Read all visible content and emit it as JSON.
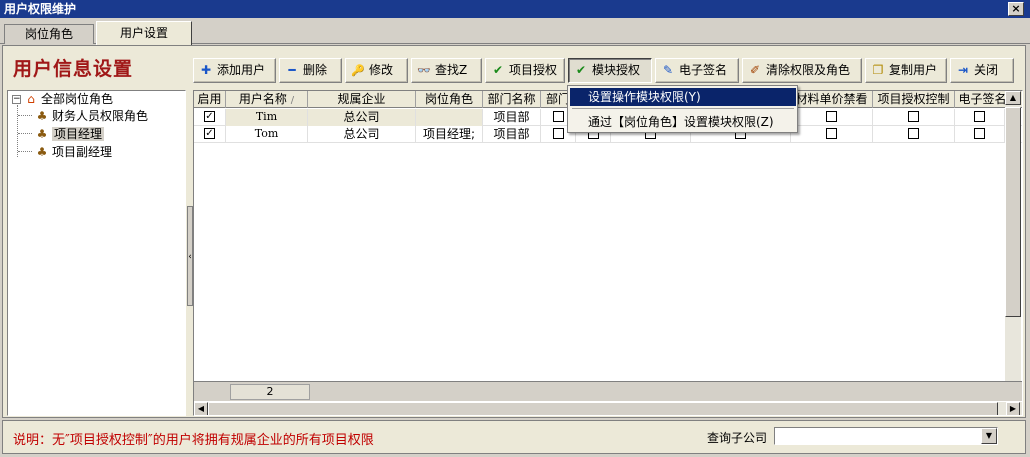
{
  "window": {
    "title": "用户权限维护",
    "close_glyph": "×"
  },
  "tabs": [
    {
      "label": "岗位角色"
    },
    {
      "label": "用户设置"
    }
  ],
  "header": {
    "title": "用户信息设置"
  },
  "toolbar": {
    "buttons": [
      {
        "label": "添加用户",
        "icon": "plus-icon",
        "glyph": "✚",
        "color": "#1a56c8"
      },
      {
        "label": "删除",
        "icon": "minus-icon",
        "glyph": "━",
        "color": "#1a56c8"
      },
      {
        "label": "修改",
        "icon": "key-icon",
        "glyph": "🔑",
        "color": "#b08800"
      },
      {
        "label": "查找Z",
        "icon": "binoculars-icon",
        "glyph": "👓",
        "color": "#000000"
      },
      {
        "label": "项目授权",
        "icon": "check-icon",
        "glyph": "✔",
        "color": "#1a8a1a"
      },
      {
        "label": "模块授权",
        "icon": "check-icon",
        "glyph": "✔",
        "color": "#1a8a1a"
      },
      {
        "label": "电子签名",
        "icon": "pen-icon",
        "glyph": "✎",
        "color": "#1a56c8"
      },
      {
        "label": "清除权限及角色",
        "icon": "brush-icon",
        "glyph": "✐",
        "color": "#a04000"
      },
      {
        "label": "复制用户",
        "icon": "copy-icon",
        "glyph": "❐",
        "color": "#b08800"
      },
      {
        "label": "关闭",
        "icon": "exit-icon",
        "glyph": "⇥",
        "color": "#1a56c8"
      }
    ]
  },
  "tree": {
    "root": {
      "label": "全部岗位角色",
      "icon": "home-icon",
      "expander": "−"
    },
    "children": [
      {
        "label": "财务人员权限角色",
        "icon": "users-icon"
      },
      {
        "label": "项目经理",
        "icon": "users-icon",
        "selected": true
      },
      {
        "label": "项目副经理",
        "icon": "users-icon"
      }
    ]
  },
  "grid": {
    "columns": [
      "启用",
      "用户名称",
      "规属企业",
      "岗位角色",
      "部门名称",
      "部门",
      "",
      "",
      "",
      "材料单价禁看",
      "项目授权控制",
      "电子签名"
    ],
    "sort_indicator": "/",
    "rows": [
      {
        "enabled": true,
        "name": "Tim",
        "company": "总公司",
        "role": "",
        "dept": "项目部"
      },
      {
        "enabled": true,
        "name": "Tom",
        "company": "总公司",
        "role": "项目经理;",
        "dept": "项目部"
      }
    ],
    "row_count": "2"
  },
  "menu": {
    "items": [
      {
        "label": "设置操作模块权限(Y)",
        "selected": true
      },
      {
        "label": "通过【岗位角色】设置模块权限(Z)",
        "selected": false
      }
    ]
  },
  "status": {
    "note": "说明：无″项目授权控制″的用户将拥有规属企业的所有项目权限",
    "query_label": "查询子公司",
    "query_value": ""
  },
  "colors": {
    "title_bg": "#1a3a8e",
    "menu_selected": "#0a246a",
    "header_text": "#a01818",
    "note_text": "#c00000"
  }
}
